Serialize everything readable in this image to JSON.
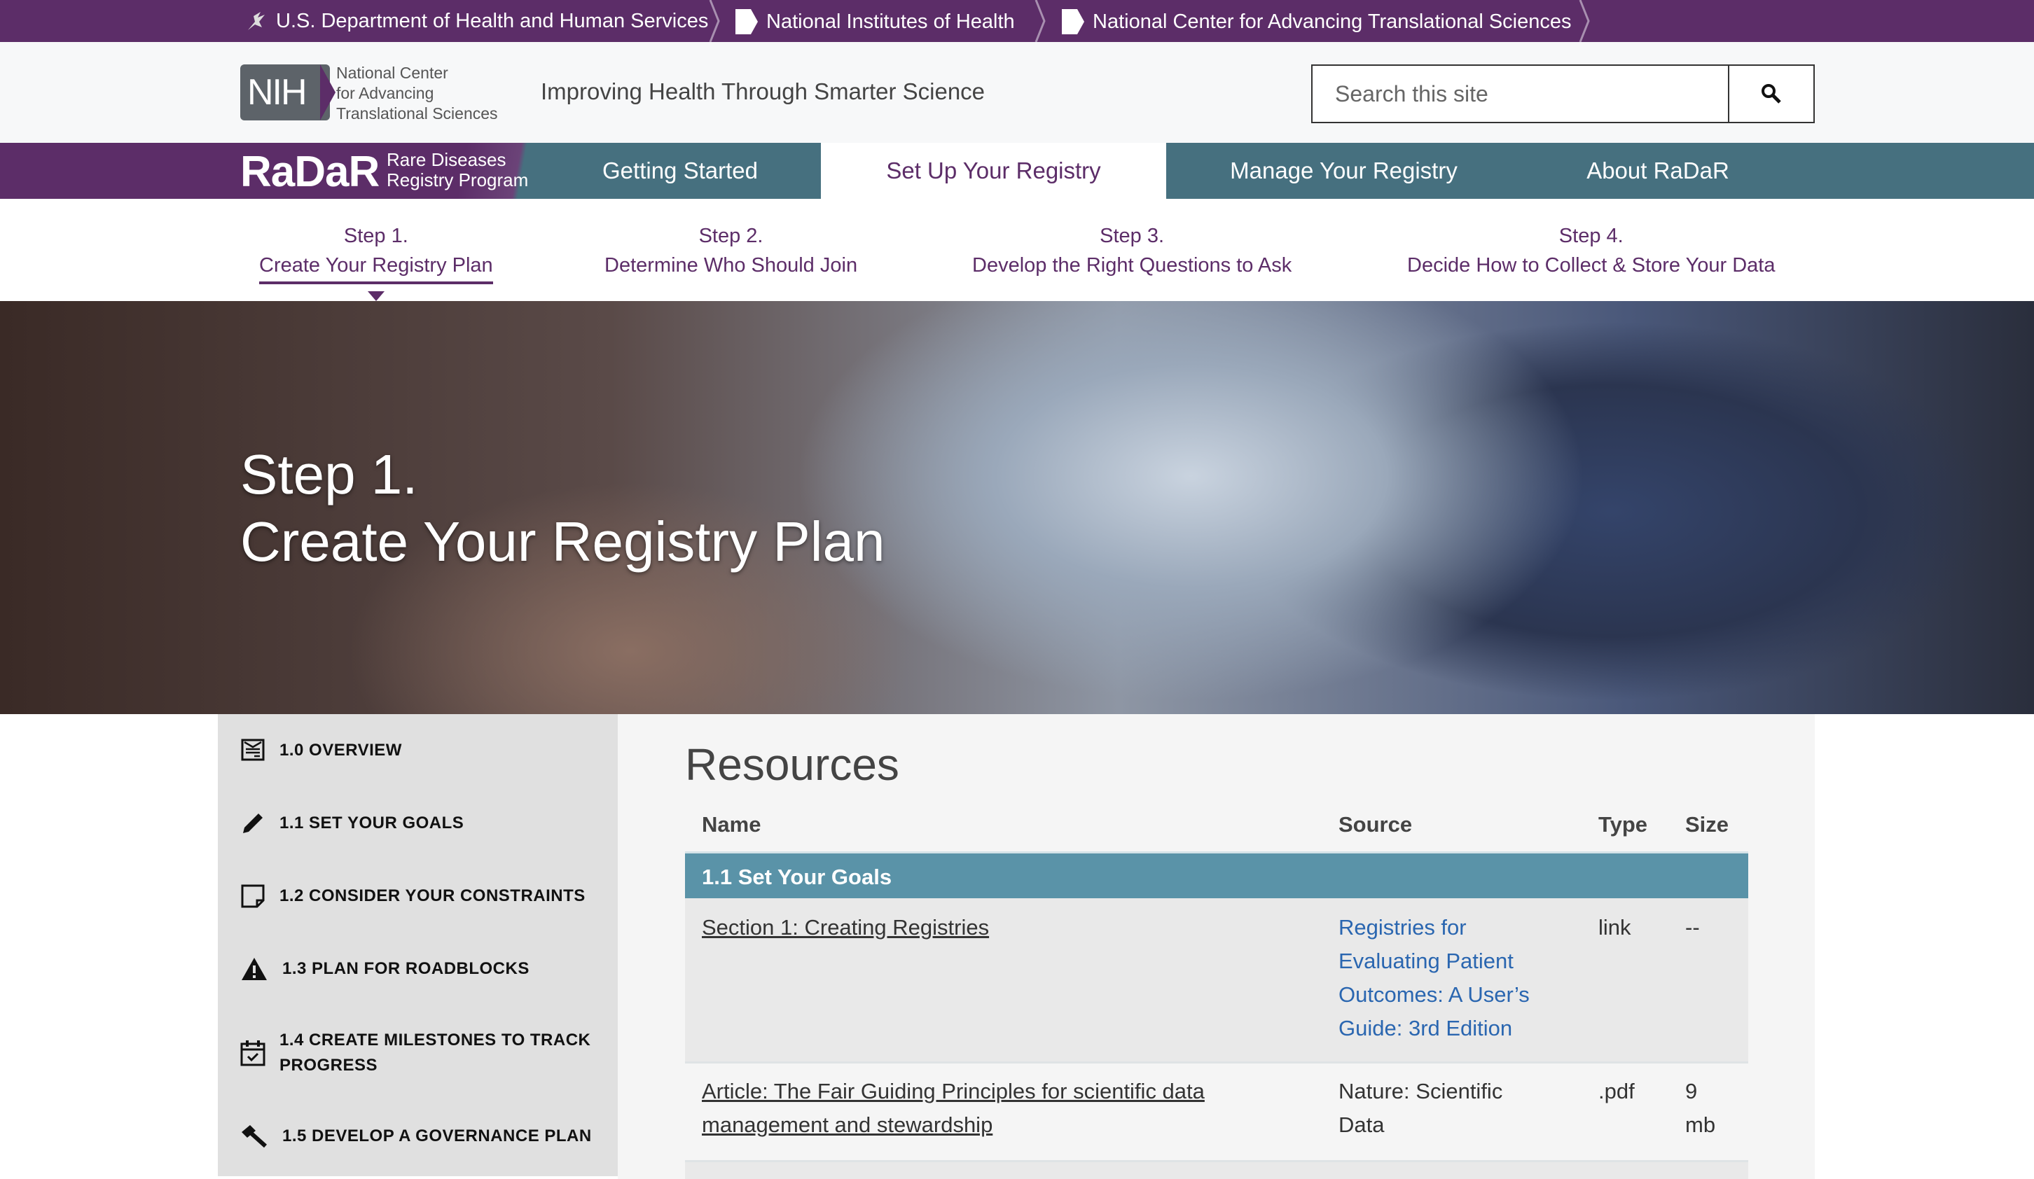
{
  "topbar": {
    "items": [
      "U.S. Department of Health and Human Services",
      "National Institutes of Health",
      "National Center for Advancing Translational Sciences"
    ]
  },
  "header": {
    "logo_text": "NIH",
    "org_name": [
      "National Center",
      "for Advancing",
      "Translational Sciences"
    ],
    "tagline": "Improving Health Through Smarter Science",
    "search_placeholder": "Search this site"
  },
  "nav": {
    "brand": "RaDaR",
    "brand_sub": [
      "Rare Diseases",
      "Registry Program"
    ],
    "tabs": [
      "Getting Started",
      "Set Up Your Registry",
      "Manage Your Registry",
      "About RaDaR"
    ],
    "active": "Set Up Your Registry"
  },
  "steps": [
    {
      "num": "Step 1.",
      "title": "Create Your Registry Plan"
    },
    {
      "num": "Step 2.",
      "title": "Determine Who Should Join"
    },
    {
      "num": "Step 3.",
      "title": "Develop the Right Questions to Ask"
    },
    {
      "num": "Step 4.",
      "title": "Decide How to Collect & Store Your Data"
    }
  ],
  "hero": {
    "line1": "Step 1.",
    "line2": "Create Your Registry Plan"
  },
  "sidebar": {
    "items": [
      {
        "label": "1.0 OVERVIEW",
        "icon": "overview-icon"
      },
      {
        "label": "1.1 SET YOUR GOALS",
        "icon": "pencil-icon"
      },
      {
        "label": "1.2 CONSIDER YOUR CONSTRAINTS",
        "icon": "note-icon"
      },
      {
        "label": "1.3 PLAN FOR ROADBLOCKS",
        "icon": "warning-icon"
      },
      {
        "label": "1.4 CREATE MILESTONES TO TRACK PROGRESS",
        "icon": "calendar-check-icon"
      },
      {
        "label": "1.5 DEVELOP A GOVERNANCE PLAN",
        "icon": "gavel-icon"
      }
    ]
  },
  "resources": {
    "title": "Resources",
    "headers": [
      "Name",
      "Source",
      "Type",
      "Size"
    ],
    "group": "1.1 Set Your Goals",
    "rows": [
      {
        "name": "Section 1: Creating Registries",
        "source": "Registries for Evaluating Patient Outcomes: A User’s Guide: 3rd Edition",
        "type": "link",
        "size": "--"
      },
      {
        "name": "Article: The Fair Guiding Principles for scientific data management and stewardship",
        "source": "Nature: Scientific Data",
        "type": ".pdf",
        "size": "9 mb"
      }
    ]
  },
  "colors": {
    "purple": "#5c2d68",
    "teal": "#46707f",
    "group": "#5a93a8",
    "link": "#2a66b0"
  }
}
